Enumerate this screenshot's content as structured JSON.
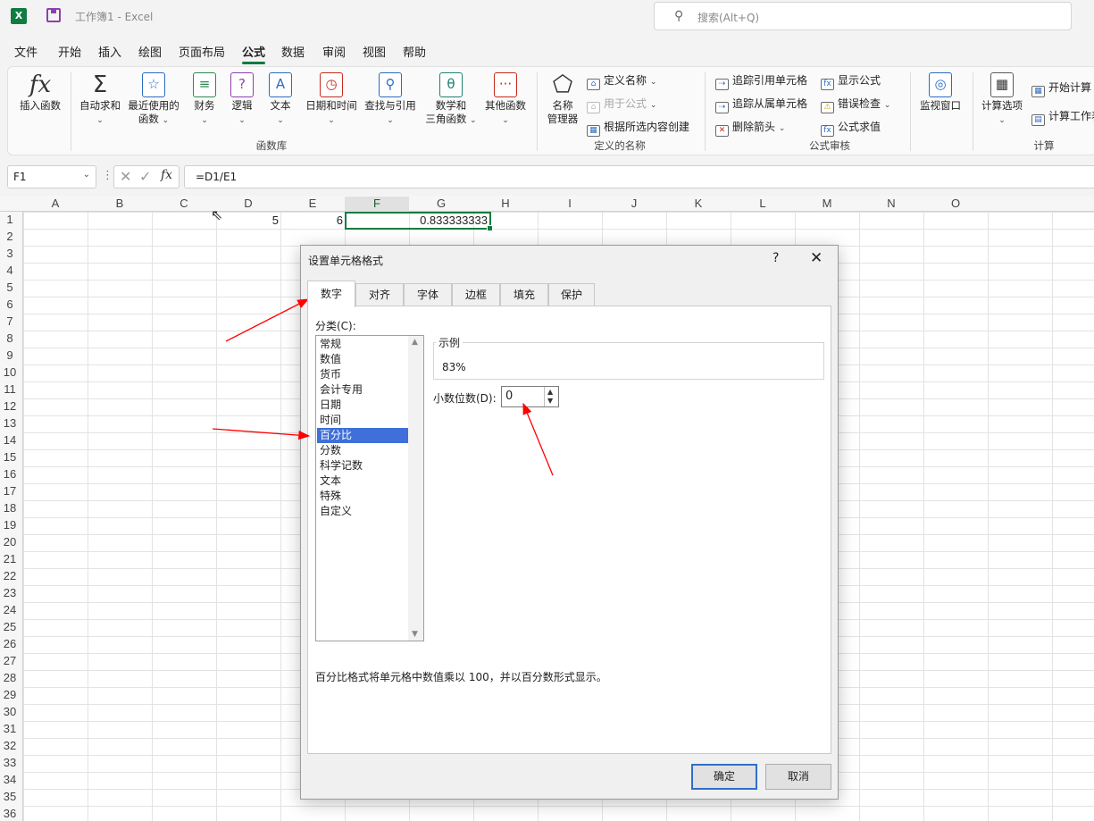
{
  "titlebar": {
    "app_icon": "X",
    "doc_title": "工作簿1 - Excel",
    "search_placeholder": "搜索(Alt+Q)"
  },
  "menu": [
    "文件",
    "开始",
    "插入",
    "绘图",
    "页面布局",
    "公式",
    "数据",
    "审阅",
    "视图",
    "帮助"
  ],
  "menu_active": "公式",
  "ribbon": {
    "insert_function": "插入函数",
    "autosum": "自动求和",
    "recent_1": "最近使用的",
    "recent_2": "函数",
    "financial": "财务",
    "logical": "逻辑",
    "text": "文本",
    "datetime": "日期和时间",
    "lookup": "查找与引用",
    "math_1": "数学和",
    "math_2": "三角函数",
    "more": "其他函数",
    "group_library": "函数库",
    "name_mgr_1": "名称",
    "name_mgr_2": "管理器",
    "define_name": "定义名称",
    "use_in_formula": "用于公式",
    "create_from_sel": "根据所选内容创建",
    "group_defined": "定义的名称",
    "trace_precedents": "追踪引用单元格",
    "trace_dependents": "追踪从属单元格",
    "remove_arrows": "删除箭头",
    "show_formulas": "显示公式",
    "error_check": "错误检查",
    "evaluate": "公式求值",
    "watch_window": "监视窗口",
    "group_audit": "公式审核",
    "calc_options": "计算选项",
    "calc_now": "开始计算",
    "calc_sheet": "计算工作表",
    "group_calc": "计算"
  },
  "formula_bar": {
    "name_box": "F1",
    "formula": "=D1/E1"
  },
  "sheet": {
    "columns": [
      "A",
      "B",
      "C",
      "D",
      "E",
      "F",
      "G",
      "H",
      "I",
      "J",
      "K",
      "L",
      "M",
      "N",
      "O"
    ],
    "rows": [
      "1",
      "2",
      "3",
      "4",
      "5",
      "6",
      "7",
      "8",
      "9",
      "10",
      "11",
      "12",
      "13",
      "14",
      "15",
      "16",
      "17",
      "18",
      "19",
      "20",
      "21",
      "22",
      "23",
      "24",
      "25",
      "26",
      "27",
      "28",
      "29",
      "30",
      "31",
      "32",
      "33",
      "34",
      "35",
      "36"
    ],
    "cells": {
      "D1": "5",
      "E1": "6",
      "F1": "0.833333333"
    },
    "selected_cell": "F1"
  },
  "dialog": {
    "title": "设置单元格格式",
    "help": "?",
    "close": "✕",
    "tabs": [
      "数字",
      "对齐",
      "字体",
      "边框",
      "填充",
      "保护"
    ],
    "active_tab": "数字",
    "category_label": "分类(C):",
    "categories": [
      "常规",
      "数值",
      "货币",
      "会计专用",
      "日期",
      "时间",
      "百分比",
      "分数",
      "科学记数",
      "文本",
      "特殊",
      "自定义"
    ],
    "selected_category": "百分比",
    "sample_label": "示例",
    "sample_value": "83%",
    "decimal_label": "小数位数(D):",
    "decimal_value": "0",
    "description": "百分比格式将单元格中数值乘以 100，并以百分数形式显示。",
    "ok": "确定",
    "cancel": "取消"
  },
  "colors": {
    "excel_green": "#107c41",
    "selection_blue": "#3f6fd8",
    "annotation_red": "#ff0000"
  }
}
